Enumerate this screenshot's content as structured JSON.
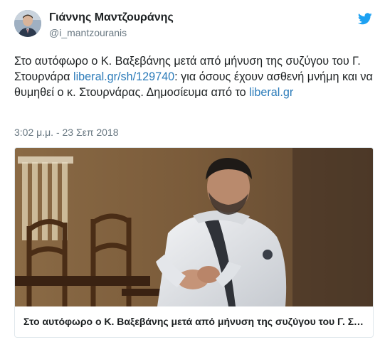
{
  "author": {
    "display_name": "Γιάννης Μαντζουράνης",
    "handle": "@i_mantzouranis"
  },
  "tweet": {
    "text_part1": "Στο αυτόφωρο ο Κ. Βαξεβάνης μετά από μήνυση της συζύγου του Γ. Στουρνάρα ",
    "link1": "liberal.gr/sh/129740",
    "text_part2": ": για όσους έχουν ασθενή μνήμη και να θυμηθεί ο κ. Στουρνάρας. Δημοσίευμα από το ",
    "link2": "liberal.gr",
    "timestamp": "3:02 μ.μ. - 23 Σεπ 2018"
  },
  "card": {
    "title": "Στο αυτόφωρο ο Κ. Βαξεβάνης μετά από μήνυση της συζύγου του Γ. Στουρνάρα"
  },
  "icons": {
    "brand": "twitter-bird-icon"
  },
  "colors": {
    "link": "#2b7bb9",
    "brand": "#1da1f2",
    "secondary_text": "#697882",
    "card_border": "#e1e8ed"
  }
}
